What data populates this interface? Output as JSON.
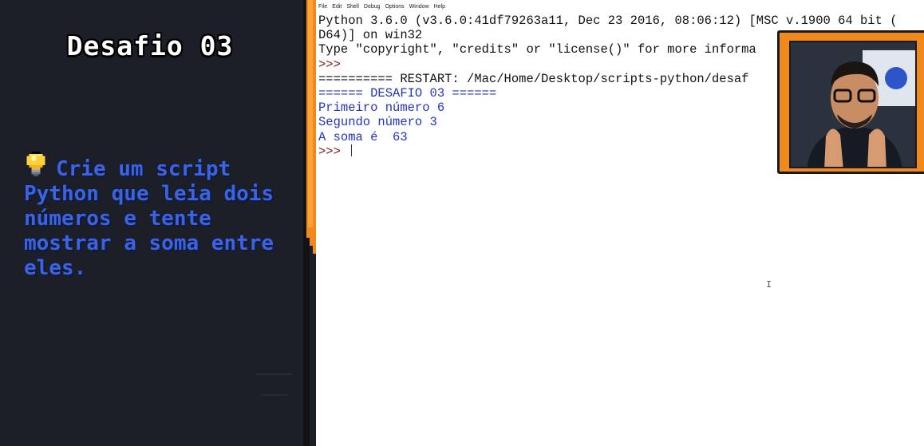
{
  "slide": {
    "title": "Desafio 03",
    "description": "Crie um script Python que leia dois números e tente mostrar a soma entre eles.",
    "bulb_icon": "lightbulb-icon"
  },
  "idle": {
    "menu": [
      "File",
      "Edit",
      "Shell",
      "Debug",
      "Options",
      "Window",
      "Help"
    ],
    "lines": {
      "version1": "Python 3.6.0 (v3.6.0:41df79263a11, Dec 23 2016, 08:06:12) [MSC v.1900 64 bit (",
      "version2": "D64)] on win32",
      "banner": "Type \"copyright\", \"credits\" or \"license()\" for more informa",
      "prompt1": ">>>",
      "restart": "========== RESTART: /Mac/Home/Desktop/scripts-python/desaf",
      "header": "====== DESAFIO 03 ======",
      "input1": "Primeiro número 6",
      "input2": "Segundo número 3",
      "result": "A soma é  63",
      "prompt2": ">>> "
    }
  },
  "colors": {
    "accent_orange": "#f08a1c",
    "text_blue": "#3d63de",
    "shell_output": "#2434c4",
    "panel_bg": "#1c1f27"
  }
}
